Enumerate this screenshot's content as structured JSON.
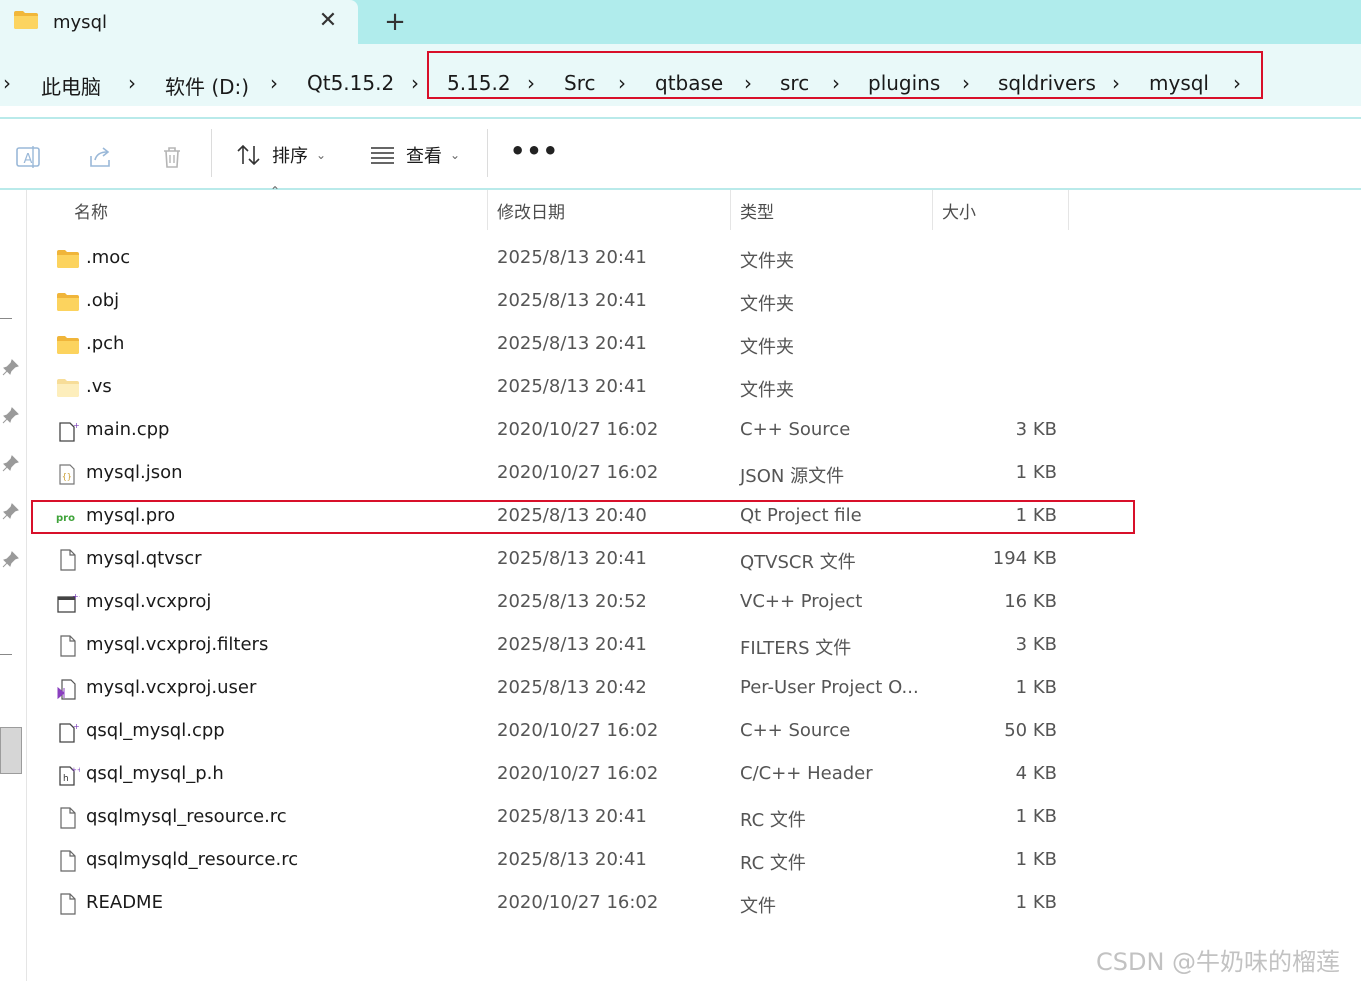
{
  "tab": {
    "title": "mysql",
    "close_glyph": "✕",
    "new_tab_glyph": "+"
  },
  "breadcrumb": {
    "leading_chevron": "›",
    "items": [
      "此电脑",
      "软件 (D:)",
      "Qt5.15.2",
      "5.15.2",
      "Src",
      "qtbase",
      "src",
      "plugins",
      "sqldrivers",
      "mysql"
    ],
    "separator": "›"
  },
  "toolbar": {
    "icons": [
      "ai-rename-icon",
      "share-icon",
      "delete-icon"
    ],
    "sort_label": "排序",
    "view_label": "查看",
    "more_label": "•••"
  },
  "columns": {
    "name": "名称",
    "modified": "修改日期",
    "type": "类型",
    "size": "大小"
  },
  "files": [
    {
      "name": ".moc",
      "date": "2025/8/13 20:41",
      "type": "文件夹",
      "size": "",
      "icon": "folder-icon"
    },
    {
      "name": ".obj",
      "date": "2025/8/13 20:41",
      "type": "文件夹",
      "size": "",
      "icon": "folder-icon"
    },
    {
      "name": ".pch",
      "date": "2025/8/13 20:41",
      "type": "文件夹",
      "size": "",
      "icon": "folder-icon"
    },
    {
      "name": ".vs",
      "date": "2025/8/13 20:41",
      "type": "文件夹",
      "size": "",
      "icon": "hidden-folder-icon"
    },
    {
      "name": "main.cpp",
      "date": "2020/10/27 16:02",
      "type": "C++ Source",
      "size": "3 KB",
      "icon": "cpp-file-icon"
    },
    {
      "name": "mysql.json",
      "date": "2020/10/27 16:02",
      "type": "JSON 源文件",
      "size": "1 KB",
      "icon": "json-file-icon"
    },
    {
      "name": "mysql.pro",
      "date": "2025/8/13 20:40",
      "type": "Qt Project file",
      "size": "1 KB",
      "icon": "qt-pro-file-icon"
    },
    {
      "name": "mysql.qtvscr",
      "date": "2025/8/13 20:41",
      "type": "QTVSCR 文件",
      "size": "194 KB",
      "icon": "generic-file-icon"
    },
    {
      "name": "mysql.vcxproj",
      "date": "2025/8/13 20:52",
      "type": "VC++ Project",
      "size": "16 KB",
      "icon": "vcxproj-file-icon"
    },
    {
      "name": "mysql.vcxproj.filters",
      "date": "2025/8/13 20:41",
      "type": "FILTERS 文件",
      "size": "3 KB",
      "icon": "generic-file-icon"
    },
    {
      "name": "mysql.vcxproj.user",
      "date": "2025/8/13 20:42",
      "type": "Per-User Project O...",
      "size": "1 KB",
      "icon": "vs-user-file-icon"
    },
    {
      "name": "qsql_mysql.cpp",
      "date": "2020/10/27 16:02",
      "type": "C++ Source",
      "size": "50 KB",
      "icon": "cpp-file-icon"
    },
    {
      "name": "qsql_mysql_p.h",
      "date": "2020/10/27 16:02",
      "type": "C/C++ Header",
      "size": "4 KB",
      "icon": "header-file-icon"
    },
    {
      "name": "qsqlmysql_resource.rc",
      "date": "2025/8/13 20:41",
      "type": "RC 文件",
      "size": "1 KB",
      "icon": "generic-file-icon"
    },
    {
      "name": "qsqlmysqld_resource.rc",
      "date": "2025/8/13 20:41",
      "type": "RC 文件",
      "size": "1 KB",
      "icon": "generic-file-icon"
    },
    {
      "name": "README",
      "date": "2020/10/27 16:02",
      "type": "文件",
      "size": "1 KB",
      "icon": "generic-file-icon"
    }
  ],
  "watermark": "CSDN @牛奶味的榴莲",
  "colors": {
    "tabbar_bg": "#b0ecec",
    "tab_active_bg": "#e9f9f9",
    "highlight_red": "#d8102a",
    "folder_yellow": "#f5c34a"
  }
}
